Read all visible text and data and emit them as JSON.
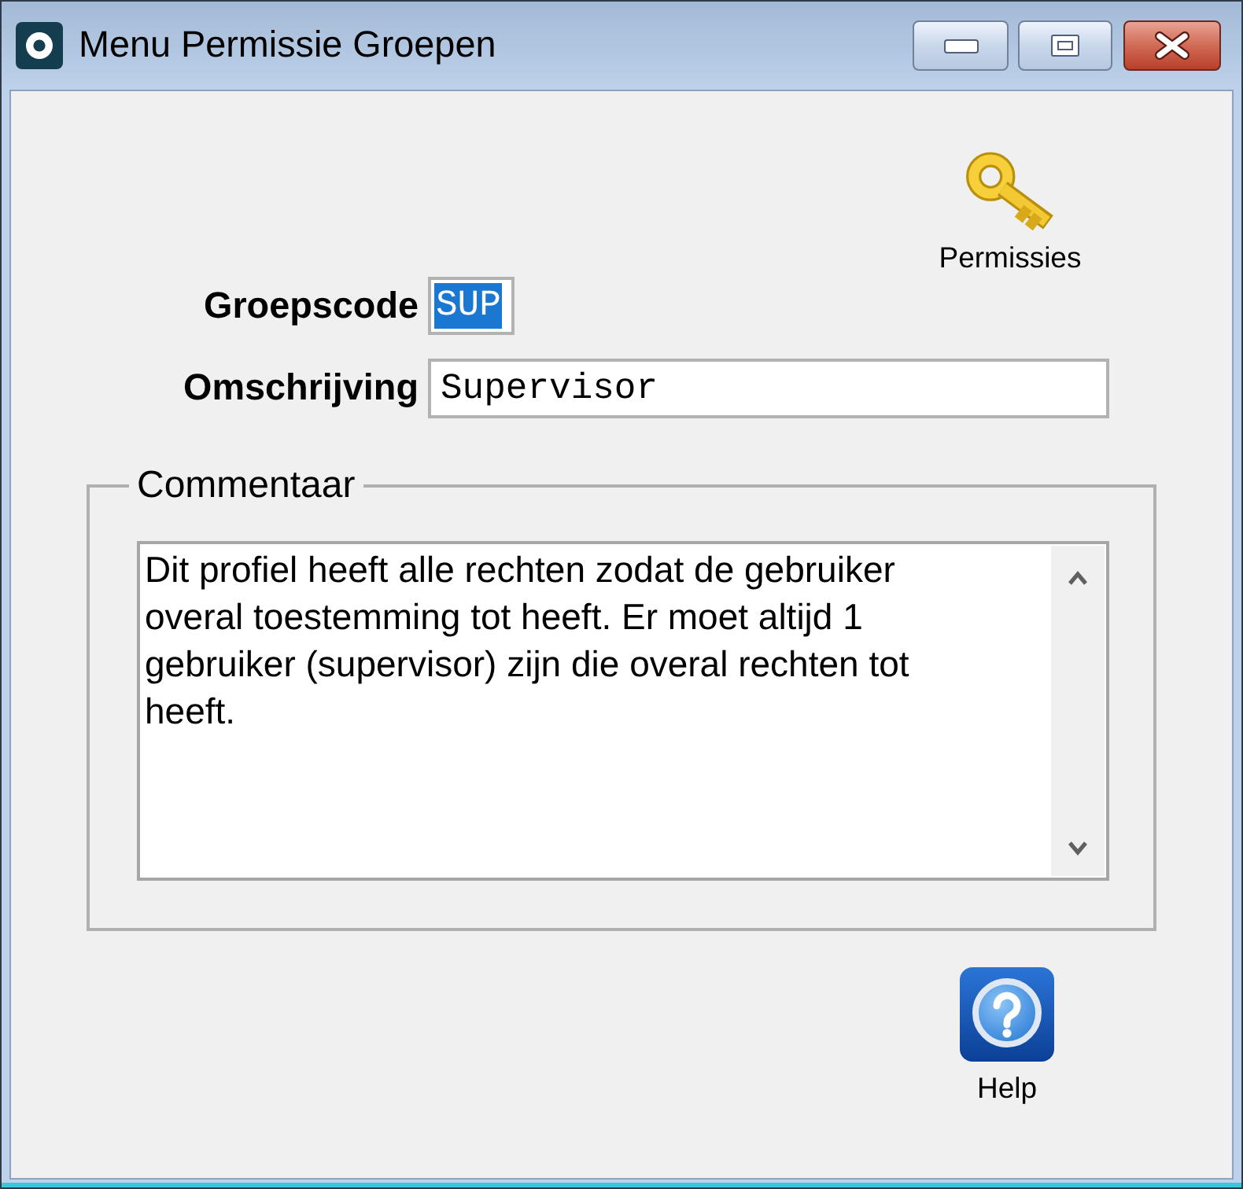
{
  "window": {
    "title": "Menu Permissie Groepen"
  },
  "toolbar": {
    "buttons": [
      {
        "label": "Permissies",
        "kind": "key"
      }
    ]
  },
  "fields": [
    {
      "label": "Groepscode",
      "value": "SUP",
      "selected": true
    },
    {
      "label": "Omschrijving",
      "value": "Supervisor",
      "selected": false
    }
  ],
  "comment_group": {
    "title": "Commentaar",
    "text": "Dit profiel heeft alle rechten zodat de gebruiker overal toestemming tot heeft. Er moet altijd 1 gebruiker (supervisor) zijn die overal rechten tot heeft."
  },
  "footer": {
    "buttons": [
      {
        "label": "Help",
        "kind": "help"
      }
    ]
  }
}
